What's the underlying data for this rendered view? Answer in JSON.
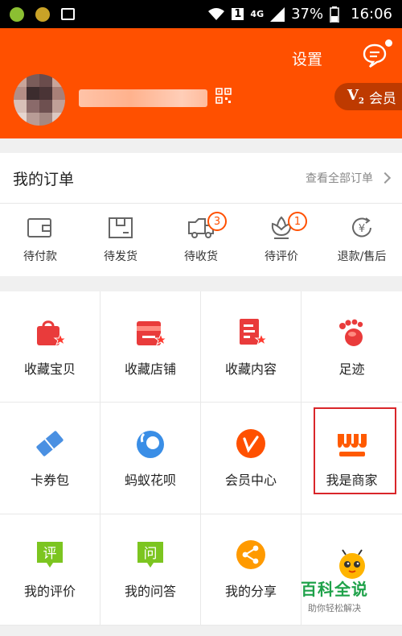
{
  "status_bar": {
    "network": "4G",
    "sim": "1",
    "battery": "37%",
    "time": "16:06"
  },
  "header": {
    "settings_label": "设置",
    "vip_badge": "V",
    "vip_level": "2",
    "vip_label": "会员"
  },
  "orders": {
    "title": "我的订单",
    "view_all": "查看全部订单",
    "items": [
      {
        "label": "待付款",
        "icon": "wallet-icon",
        "badge": ""
      },
      {
        "label": "待发货",
        "icon": "package-icon",
        "badge": ""
      },
      {
        "label": "待收货",
        "icon": "truck-icon",
        "badge": "3"
      },
      {
        "label": "待评价",
        "icon": "flower-icon",
        "badge": "1"
      },
      {
        "label": "退款/售后",
        "icon": "refund-icon",
        "badge": ""
      }
    ]
  },
  "grid": [
    {
      "label": "收藏宝贝",
      "icon": "bag-star-icon"
    },
    {
      "label": "收藏店铺",
      "icon": "store-star-icon"
    },
    {
      "label": "收藏内容",
      "icon": "doc-star-icon"
    },
    {
      "label": "足迹",
      "icon": "footprint-icon"
    },
    {
      "label": "卡券包",
      "icon": "ticket-icon"
    },
    {
      "label": "蚂蚁花呗",
      "icon": "huabei-icon"
    },
    {
      "label": "会员中心",
      "icon": "vip-center-icon"
    },
    {
      "label": "我是商家",
      "icon": "merchant-icon"
    },
    {
      "label": "我的评价",
      "icon": "review-icon"
    },
    {
      "label": "我的问答",
      "icon": "qa-icon"
    },
    {
      "label": "我的分享",
      "icon": "share-icon"
    },
    {
      "label": "",
      "icon": "bee-icon"
    }
  ],
  "review_icon_char": "评",
  "qa_icon_char": "问",
  "watermark": {
    "main": "百科全说",
    "sub": "助你轻松解决"
  },
  "colors": {
    "brand": "#ff5000",
    "star": "#ff3a2f",
    "highlight": "#d9262a",
    "watermark": "#1fa24a"
  }
}
